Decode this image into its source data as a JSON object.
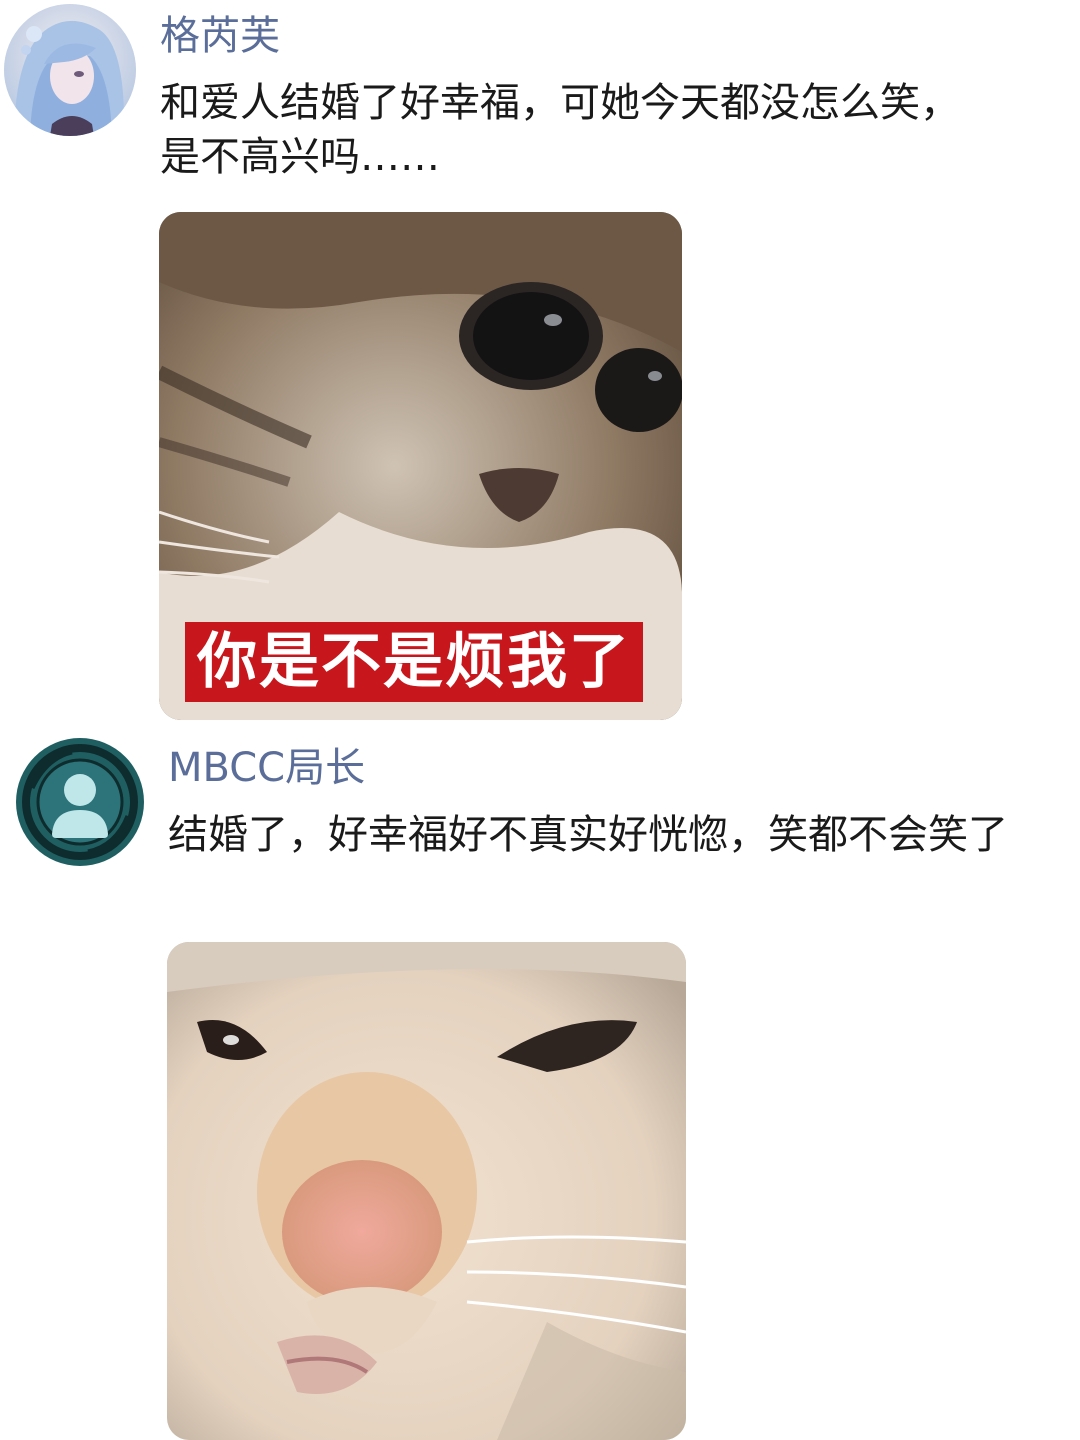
{
  "posts": [
    {
      "username": "格芮芙",
      "message": "和爱人结婚了好幸福，可她今天都没怎么笑，是不高兴吗……",
      "image_caption": "你是不是烦我了",
      "image_icon": "tabby-kitten-photo"
    },
    {
      "username": "MBCC局长",
      "message": "结婚了，好幸福好不真实好恍惚，笑都不会笑了",
      "image_icon": "squinting-cat-photo"
    }
  ],
  "colors": {
    "username": "#5b6e9a",
    "caption_bg": "#c8161d",
    "avatar2_teal": "#1f5f62"
  }
}
